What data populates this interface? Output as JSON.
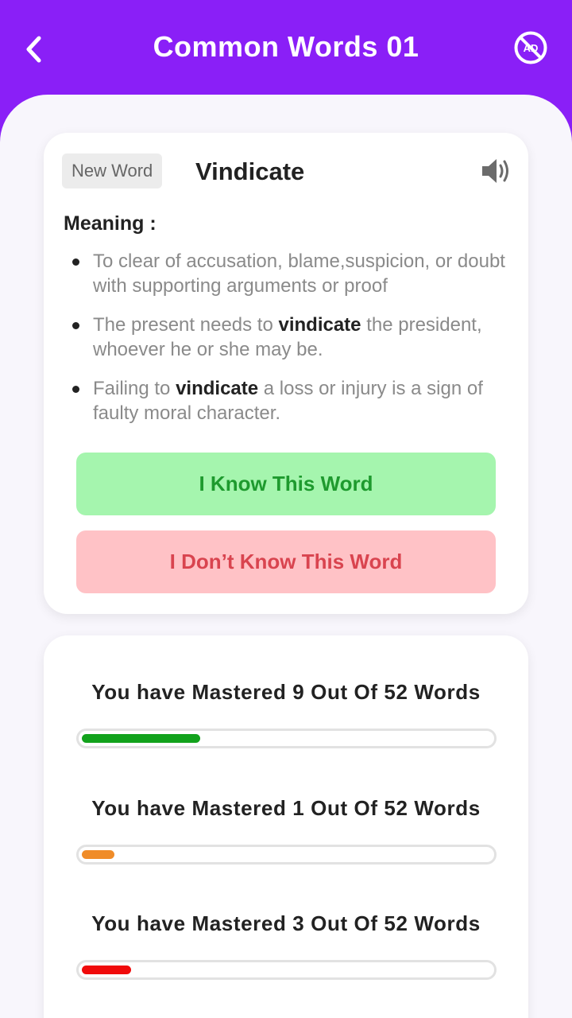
{
  "header": {
    "title": "Common Words 01",
    "ad_icon_text": "AD"
  },
  "word_card": {
    "badge": "New Word",
    "word": "Vindicate",
    "meaning_label": "Meaning :",
    "bullets": [
      {
        "parts": [
          "To clear of accusation, blame,suspicion, or doubt with supporting arguments or proof"
        ]
      },
      {
        "parts": [
          "The present needs to ",
          "vindicate",
          " the president, whoever he or she may be."
        ]
      },
      {
        "parts": [
          "Failing to ",
          "vindicate",
          " a loss or injury is a sign of faulty moral character."
        ]
      }
    ],
    "know_label": "I Know This Word",
    "dont_know_label": "I Don’t Know This Word"
  },
  "progress": [
    {
      "label": "You have Mastered 9 Out Of 52 Words",
      "mastered": 9,
      "total": 52,
      "fraction": 0.29,
      "color": "#12a21c"
    },
    {
      "label": "You have Mastered 1 Out Of 52 Words",
      "mastered": 1,
      "total": 52,
      "fraction": 0.08,
      "color": "#f08c28"
    },
    {
      "label": "You have Mastered 3 Out Of 52 Words",
      "mastered": 3,
      "total": 52,
      "fraction": 0.12,
      "color": "#f00b0b"
    }
  ],
  "colors": {
    "header_bg": "#8a1ff7",
    "know_bg": "#a5f5ae",
    "know_text": "#1e9a2e",
    "dont_bg": "#ffc2c6",
    "dont_text": "#d9444f"
  }
}
